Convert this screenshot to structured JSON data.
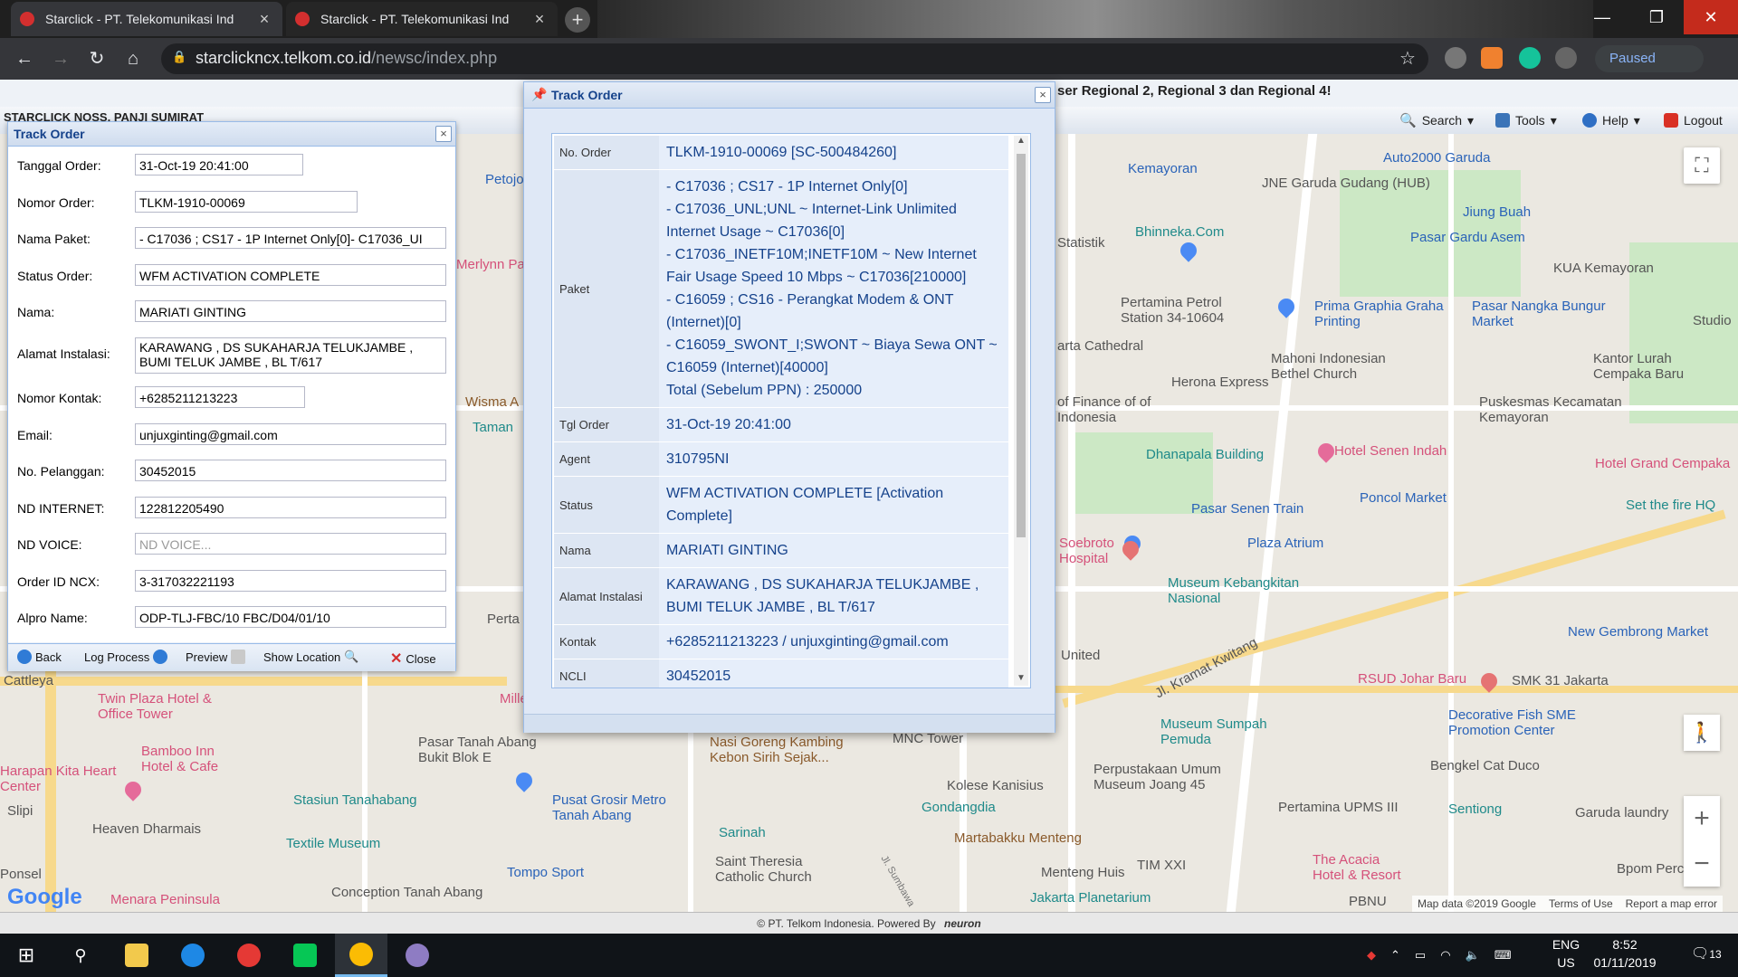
{
  "browser": {
    "tabs": [
      {
        "title": "Starclick - PT. Telekomunikasi Ind"
      },
      {
        "title": "Starclick - PT. Telekomunikasi Ind"
      }
    ],
    "url_host": "starclickncx.telkom.co.id",
    "url_path": "/newsc/index.php",
    "profile_status": "Paused"
  },
  "app": {
    "marquee": "ser Regional 2, Regional 3 dan Regional 4!",
    "user_label": "STARCLICK NOSS, PANJI SUMIRAT",
    "menu": {
      "search": "Search",
      "tools": "Tools",
      "help": "Help",
      "logout": "Logout"
    },
    "footer": "© PT. Telkom Indonesia. Powered By",
    "footer_brand": "neuron"
  },
  "left_panel": {
    "title": "Track Order",
    "fields": [
      {
        "label": "Tanggal Order:",
        "value": "31-Oct-19 20:41:00"
      },
      {
        "label": "Nomor Order:",
        "value": "TLKM-1910-00069"
      },
      {
        "label": "Nama Paket:",
        "value": "- C17036 ; CS17 - 1P Internet Only[0]- C17036_UI"
      },
      {
        "label": "Status Order:",
        "value": "WFM ACTIVATION COMPLETE"
      },
      {
        "label": "Nama:",
        "value": "MARIATI GINTING"
      },
      {
        "label": "Alamat Instalasi:",
        "value": "KARAWANG , DS SUKAHARJA TELUKJAMBE , BUMI TELUK JAMBE , BL T/617"
      },
      {
        "label": "Nomor Kontak:",
        "value": "+6285211213223"
      },
      {
        "label": "Email:",
        "value": "unjuxginting@gmail.com"
      },
      {
        "label": "No. Pelanggan:",
        "value": "30452015"
      },
      {
        "label": "ND INTERNET:",
        "value": "122812205490"
      },
      {
        "label": "ND VOICE:",
        "placeholder": "ND VOICE..."
      },
      {
        "label": "Order ID NCX:",
        "value": "3-317032221193"
      },
      {
        "label": "Alpro Name:",
        "value": "ODP-TLJ-FBC/10 FBC/D04/01/10"
      }
    ],
    "buttons": {
      "back": "Back",
      "log": "Log Process",
      "preview": "Preview",
      "location": "Show Location",
      "close": "Close"
    }
  },
  "modal": {
    "title": "Track Order",
    "rows": [
      {
        "key": "No. Order",
        "lines": [
          "TLKM-1910-00069 [SC-500484260]"
        ]
      },
      {
        "key": "Paket",
        "lines": [
          "- C17036 ; CS17 - 1P Internet Only[0]",
          "- C17036_UNL;UNL ~ Internet-Link Unlimited Internet Usage ~ C17036[0]",
          "- C17036_INETF10M;INETF10M ~ New Internet Fair Usage Speed 10 Mbps ~ C17036[210000]",
          "- C16059 ; CS16 - Perangkat Modem & ONT (Internet)[0]",
          "- C16059_SWONT_I;SWONT ~ Biaya Sewa ONT ~ C16059 (Internet)[40000]",
          "Total (Sebelum PPN) : 250000"
        ]
      },
      {
        "key": "Tgl Order",
        "lines": [
          "31-Oct-19 20:41:00"
        ]
      },
      {
        "key": "Agent",
        "lines": [
          "310795NI"
        ]
      },
      {
        "key": "Status",
        "lines": [
          "WFM ACTIVATION COMPLETE [Activation Complete]"
        ]
      },
      {
        "key": "Nama",
        "lines": [
          "MARIATI GINTING"
        ]
      },
      {
        "key": "Alamat Instalasi",
        "lines": [
          "KARAWANG , DS SUKAHARJA TELUKJAMBE , BUMI TELUK JAMBE , BL T/617"
        ]
      },
      {
        "key": "Kontak",
        "lines": [
          "+6285211213223 / unjuxginting@gmail.com"
        ]
      },
      {
        "key": "NCLI",
        "lines": [
          "30452015"
        ]
      }
    ]
  },
  "map": {
    "labels": [
      "Kemayoran",
      "Auto2000 Garuda",
      "JNE Garuda Gudang (HUB)",
      "Jiung Buah",
      "Bhinneka.Com",
      "Pasar Gardu Asem",
      "KUA Kemayoran",
      "Pertamina Petrol Station 34-10604",
      "Prima Graphia Graha Printing",
      "Pasar Nangka Bungur Market",
      "Studio",
      "Mahoni Indonesian Bethel Church",
      "Kantor Lurah Cempaka Baru",
      "Herona Express",
      "Puskesmas Kecamatan Kemayoran",
      "Dhanapala Building",
      "Hotel Senen Indah",
      "Hotel Grand Cempaka",
      "Pasar Senen Train",
      "Poncol Market",
      "Set the fire HQ",
      "Plaza Atrium",
      "Soebroto Hospital",
      "Museum Kebangkitan Nasional",
      "New Gembrong Market",
      "RSUD Johar Baru",
      "SMK 31 Jakarta",
      "Decorative Fish SME Promotion Center",
      "Museum Sumpah Pemuda",
      "Bengkel Cat Duco",
      "Perpustakaan Umum Museum Joang 45",
      "Pertamina UPMS III",
      "Sentiong",
      "Garuda laundry",
      "Martabakku Menteng",
      "Kolese Kanisius",
      "Gondangdia",
      "MNC Tower",
      "Nasi Goreng Kambing Kebon Sirih Sejak...",
      "Pusat Grosir Metro Tanah Abang",
      "Pasar Tanah Abang Bukit Blok E",
      "Stasiun Tanahabang",
      "Textile Museum",
      "Sarinah",
      "Saint Theresia Catholic Church",
      "Menteng Huis",
      "TIM XXI",
      "Jakarta Planetarium",
      "The Acacia Hotel & Resort",
      "Bpom Percetak",
      "Tompo Sport",
      "Conception Tanah Abang",
      "Heaven Dharmais",
      "Bamboo Inn Hotel & Cafe",
      "Harapan Kita Heart Center",
      "Twin Plaza Hotel & Office Tower",
      "Menara Peninsula",
      "Cattleya",
      "Petojo Tradi",
      "Merlynn Pa",
      "Wisma A",
      "Taman",
      "Statistik",
      "arta Cathedral",
      "of Finance of of Indonesia",
      "Jl. Kramat Kwitang",
      "United",
      "Jl. Sumbawa",
      "Millenni",
      "Perta",
      "PBNU",
      "Slipi",
      "Ponsel"
    ],
    "attribution": {
      "data": "Map data ©2019 Google",
      "terms": "Terms of Use",
      "report": "Report a map error"
    },
    "logo": "Google"
  },
  "taskbar": {
    "lang_line1": "ENG",
    "lang_line2": "US",
    "time": "8:52",
    "date": "01/11/2019",
    "notif_count": "13"
  },
  "colors": {
    "panel_title": "#15428b",
    "panel_border": "#99bbe8",
    "value_text": "#15428b"
  }
}
